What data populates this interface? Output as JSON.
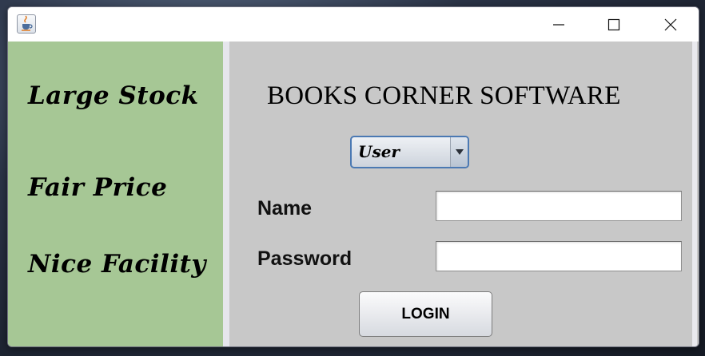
{
  "window": {
    "icon": "java-cup-icon",
    "controls": {
      "minimize": "minimize-icon",
      "maximize": "maximize-icon",
      "close": "close-icon"
    }
  },
  "sidebar": {
    "slogans": [
      "Large Stock",
      "Fair Price",
      "Nice Facility"
    ],
    "background": "#a6c795"
  },
  "main": {
    "title": "BOOKS CORNER SOFTWARE",
    "role_select": {
      "selected": "User"
    },
    "name_field": {
      "label": "Name",
      "value": ""
    },
    "password_field": {
      "label": "Password",
      "value": ""
    },
    "login_label": "LOGIN",
    "background": "#c8c8c8"
  }
}
